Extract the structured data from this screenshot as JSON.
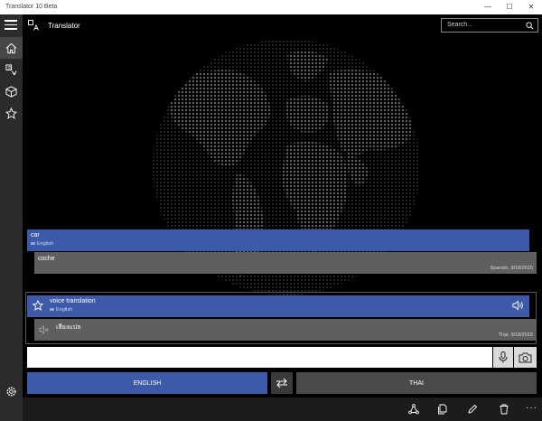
{
  "window": {
    "title": "Translator 10 Beta",
    "minimize": "—",
    "maximize": "☐",
    "close": "✕"
  },
  "header": {
    "title": "Translator",
    "search_placeholder": "Search..."
  },
  "nav": [
    {
      "icon": "home-icon",
      "active": true
    },
    {
      "icon": "translate-icon",
      "active": false
    },
    {
      "icon": "box-icon",
      "active": false
    },
    {
      "icon": "star-icon",
      "active": false
    }
  ],
  "entries": [
    {
      "source_text": "car",
      "source_lang": "English",
      "translation": "coche",
      "meta": "Spanish, 9/18/2015"
    },
    {
      "source_text": "voice translation",
      "source_lang": "English",
      "translation": "เสียงแปล",
      "meta": "Thai, 9/18/2015"
    }
  ],
  "input": {
    "value": ""
  },
  "languages": {
    "from": "ENGLISH",
    "to": "THAI"
  },
  "colors": {
    "accent": "#3d5aa8",
    "translation_bg": "#5f5f5f",
    "rail": "#2b2b2b"
  }
}
